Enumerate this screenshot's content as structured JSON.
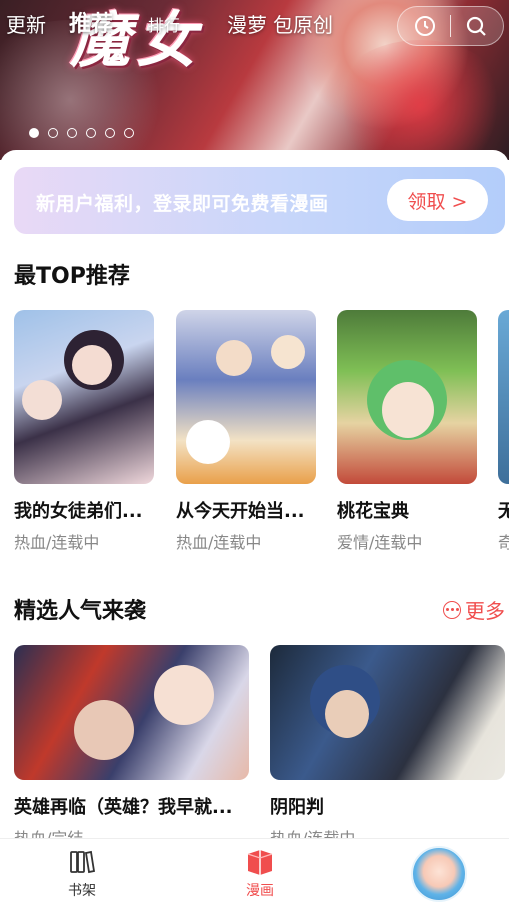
{
  "header": {
    "tabs": [
      {
        "label": "更新",
        "active": false
      },
      {
        "label": "推荐",
        "active": true
      },
      {
        "label": "排行",
        "active": false
      },
      {
        "label": "漫萝",
        "active": false
      },
      {
        "label": "包原创",
        "active": false
      }
    ],
    "banner_art_text": "魔女",
    "icons": [
      "history-icon",
      "search-icon"
    ],
    "carousel_count": 6,
    "carousel_active": 0
  },
  "promo": {
    "text": "新用户福利，登录即可免费看漫画",
    "button": "领取 >"
  },
  "top_section": {
    "title": "最TOP推荐",
    "items": [
      {
        "name": "我的女徒弟们...",
        "tags": "热血/连载中"
      },
      {
        "name": "从今天开始当...",
        "tags": "热血/连载中"
      },
      {
        "name": "桃花宝典",
        "tags": "爱情/连载中"
      },
      {
        "name": "无",
        "tags": "奇"
      }
    ]
  },
  "popular_section": {
    "title": "精选人气来袭",
    "more_label": "更多",
    "items": [
      {
        "name": "英雄再临（英雄？我早就...",
        "tags": "热血/完结"
      },
      {
        "name": "阴阳判",
        "tags": "热血/连载中"
      }
    ]
  },
  "tabbar": {
    "items": [
      {
        "label": "书架",
        "icon": "bookshelf-icon",
        "active": false
      },
      {
        "label": "漫画",
        "icon": "comic-icon",
        "active": true
      }
    ],
    "avatar": "profile-avatar"
  },
  "colors": {
    "accent": "#f04e4e",
    "promo_gradient_start": "#e9d9f6",
    "promo_gradient_end": "#b3cdfa"
  }
}
